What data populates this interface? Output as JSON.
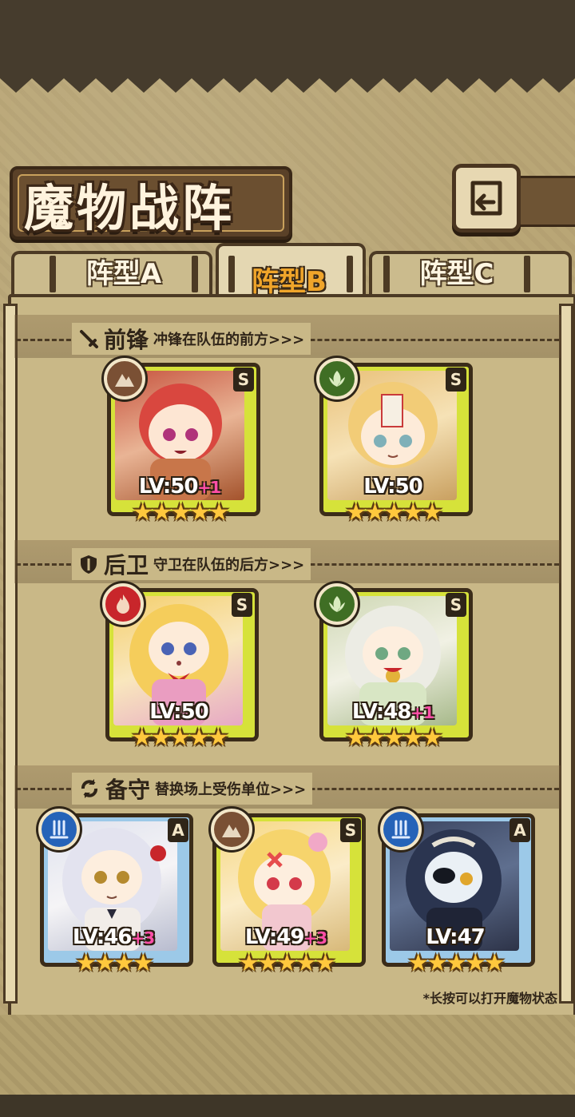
{
  "title": "魔物战阵",
  "tabs": [
    {
      "label": "阵型A",
      "active": false
    },
    {
      "label": "阵型B",
      "active": true
    },
    {
      "label": "阵型C",
      "active": false
    }
  ],
  "sections": {
    "front": {
      "icon": "sword-icon",
      "name": "前锋",
      "desc": "冲锋在队伍的前方>>>"
    },
    "back": {
      "icon": "shield-icon",
      "name": "后卫",
      "desc": "守卫在队伍的后方>>>"
    },
    "reserve": {
      "icon": "swap-arrows-icon",
      "name": "备守",
      "desc": "替换场上受伤单位>>>"
    }
  },
  "cards": {
    "front1": {
      "element": "earth",
      "rank": "S",
      "lv": "LV:50",
      "bonus": "+1",
      "stars": 5
    },
    "front2": {
      "element": "wind",
      "rank": "S",
      "lv": "LV:50",
      "bonus": "",
      "stars": 5
    },
    "back1": {
      "element": "fire",
      "rank": "S",
      "lv": "LV:50",
      "bonus": "",
      "stars": 5
    },
    "back2": {
      "element": "wind",
      "rank": "S",
      "lv": "LV:48",
      "bonus": "+1",
      "stars": 5
    },
    "res1": {
      "element": "water",
      "rank": "A",
      "lv": "LV:46",
      "bonus": "+3",
      "stars": 4
    },
    "res2": {
      "element": "earth",
      "rank": "S",
      "lv": "LV:49",
      "bonus": "+3",
      "stars": 5
    },
    "res3": {
      "element": "water",
      "rank": "A",
      "lv": "LV:47",
      "bonus": "",
      "stars": 5
    }
  },
  "stars_text": {
    "five": "★★★★★",
    "four": "★★★★"
  },
  "hint": "*长按可以打开魔物状态",
  "colors": {
    "s_frame": "#d6e23a",
    "a_frame": "#9cc9e8",
    "fire": "#c8262b",
    "wind": "#3f6e24",
    "earth": "#7a5034",
    "water": "#2563b8"
  }
}
